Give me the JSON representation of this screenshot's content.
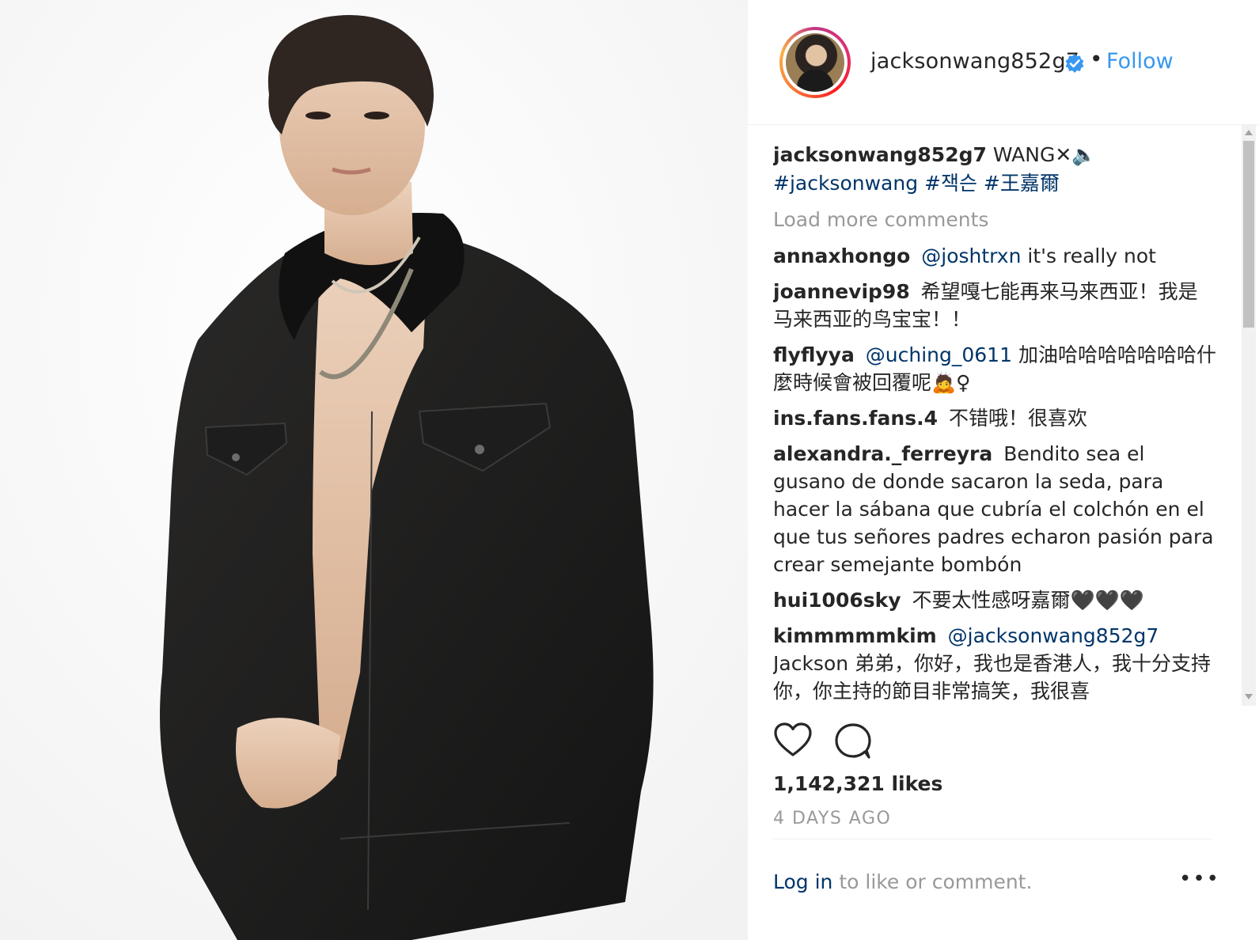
{
  "header": {
    "username": "jacksonwang852g7",
    "separator": "•",
    "follow_label": "Follow"
  },
  "caption": {
    "username": "jacksonwang852g7",
    "text": "WANG✕🔈",
    "tags": "#jacksonwang #잭슨 #王嘉爾"
  },
  "load_more": "Load more comments",
  "comments": [
    {
      "user": "annaxhongo",
      "mention": "@joshtrxn",
      "text": "it's really not"
    },
    {
      "user": "joannevip98",
      "mention": "",
      "text": "希望嘎七能再来马来西亚！我是马来西亚的鸟宝宝！！"
    },
    {
      "user": "flyflyya",
      "mention": "@uching_0611",
      "text": "加油哈哈哈哈哈哈哈什麼時候會被回覆呢🙇♀"
    },
    {
      "user": "ins.fans.fans.4",
      "mention": "",
      "text": "不错哦！很喜欢"
    },
    {
      "user": "alexandra._ferreyra",
      "mention": "",
      "text": "Bendito sea el gusano de donde sacaron la seda, para hacer la sábana que cubría el colchón en el que tus señores padres echaron pasión para crear semejante bombón"
    },
    {
      "user": "hui1006sky",
      "mention": "",
      "text": "不要太性感呀嘉爾🖤🖤🖤"
    },
    {
      "user": "kimmmmmkim",
      "mention": "@jacksonwang852g7",
      "text": "Jackson 弟弟，你好，我也是香港人，我十分支持你，你主持的節目非常搞笑，我很喜"
    }
  ],
  "likes": "1,142,321 likes",
  "time": "4 DAYS AGO",
  "login": {
    "link": "Log in",
    "rest": " to like or comment."
  },
  "more_label": "•••",
  "icons": {
    "heart": "heart-icon",
    "comment": "comment-icon",
    "verified": "verified-badge-icon",
    "more": "more-options-icon"
  }
}
